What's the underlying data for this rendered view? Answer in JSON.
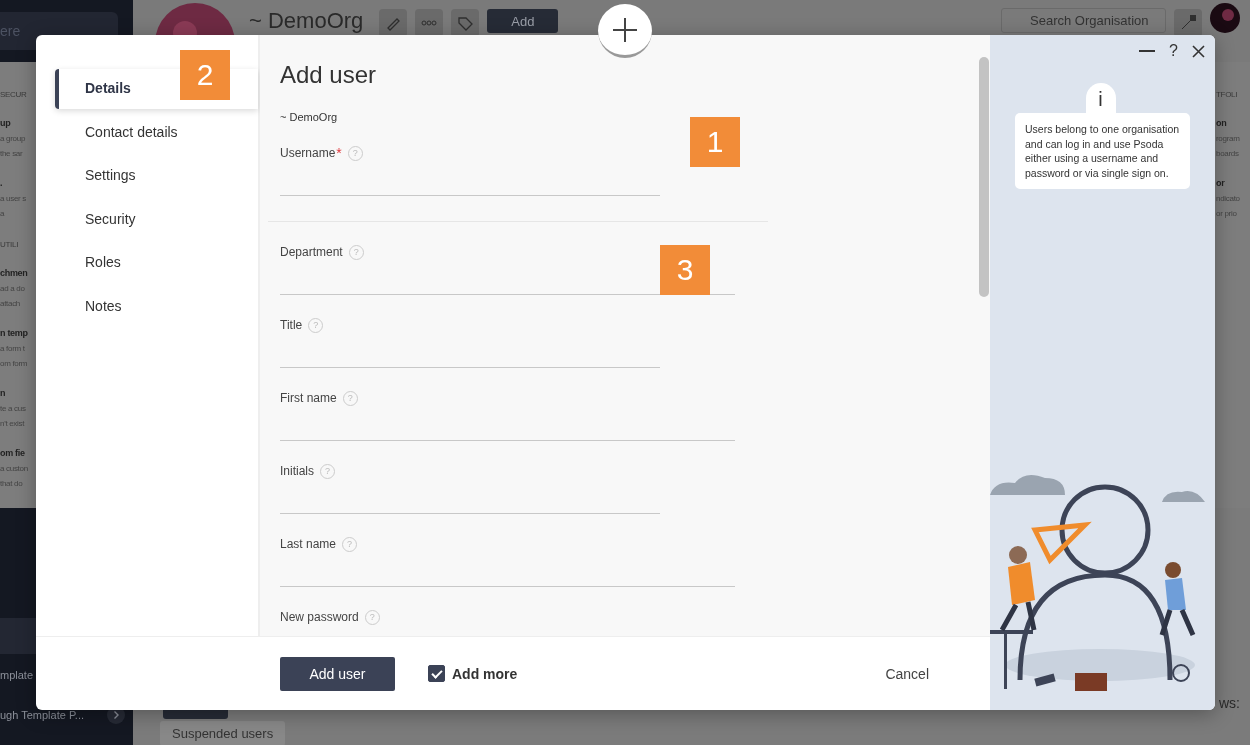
{
  "background": {
    "sidebar": {
      "search_placeholder": "ere",
      "items": [
        {
          "label": "mplate",
          "chevron": false
        },
        {
          "label": "ugh Template P...",
          "chevron": true
        }
      ]
    },
    "topbar": {
      "org_name": "~ DemoOrg",
      "add_button": "Add",
      "search_placeholder": "Search Organisation"
    },
    "add_menu": {
      "left": [
        {
          "kind": "heading",
          "text": "SECUR"
        },
        {
          "kind": "item",
          "title": "up",
          "lines": [
            "a group",
            "the sar"
          ]
        },
        {
          "kind": "item",
          "title": ".",
          "lines": [
            "a user s",
            "a"
          ]
        },
        {
          "kind": "heading",
          "text": "UTILI"
        },
        {
          "kind": "item",
          "title": "chmen",
          "lines": [
            "ad a do",
            "attach"
          ]
        },
        {
          "kind": "item",
          "title": "n temp",
          "lines": [
            "a form t",
            "om form"
          ]
        },
        {
          "kind": "item",
          "title": "n",
          "lines": [
            "te a cus",
            "n't exist"
          ]
        },
        {
          "kind": "item",
          "title": "om fie",
          "lines": [
            "a custon",
            "that do"
          ]
        }
      ],
      "right": [
        {
          "kind": "heading",
          "text": "TFOLI"
        },
        {
          "kind": "item",
          "title": "on",
          "lines": [
            "rogram",
            "boards"
          ]
        },
        {
          "kind": "item",
          "title": "or",
          "lines": [
            "ndicato",
            "or prio"
          ]
        }
      ]
    },
    "page": {
      "rows_label": "ws:",
      "suspended_button": "Suspended users"
    }
  },
  "modal": {
    "title": "Add user",
    "org": "~ DemoOrg",
    "required_mark": "*",
    "help": "?",
    "nav": [
      {
        "label": "Details",
        "selected": true
      },
      {
        "label": "Contact details",
        "selected": false
      },
      {
        "label": "Settings",
        "selected": false
      },
      {
        "label": "Security",
        "selected": false
      },
      {
        "label": "Roles",
        "selected": false
      },
      {
        "label": "Notes",
        "selected": false
      }
    ],
    "fields": [
      {
        "label": "Username",
        "hint": "?",
        "required": true
      },
      {
        "label": "Department",
        "hint": "?",
        "required": false
      },
      {
        "label": "Title",
        "hint": "?",
        "required": false
      },
      {
        "label": "First name",
        "hint": "?",
        "required": false
      },
      {
        "label": "Initials",
        "hint": "?",
        "required": false
      },
      {
        "label": "Last name",
        "hint": "?",
        "required": false
      },
      {
        "label": "New password",
        "hint": "?",
        "required": false
      }
    ],
    "info_icon": "i",
    "info_text": "Users belong to one organisation and can log in and use Psoda either using a username and password or via single sign on.",
    "footer": {
      "submit": "Add user",
      "add_more": {
        "label": "Add more",
        "checked": true
      },
      "cancel": "Cancel"
    }
  },
  "annotations": [
    {
      "label": "1"
    },
    {
      "label": "2"
    },
    {
      "label": "3"
    }
  ]
}
